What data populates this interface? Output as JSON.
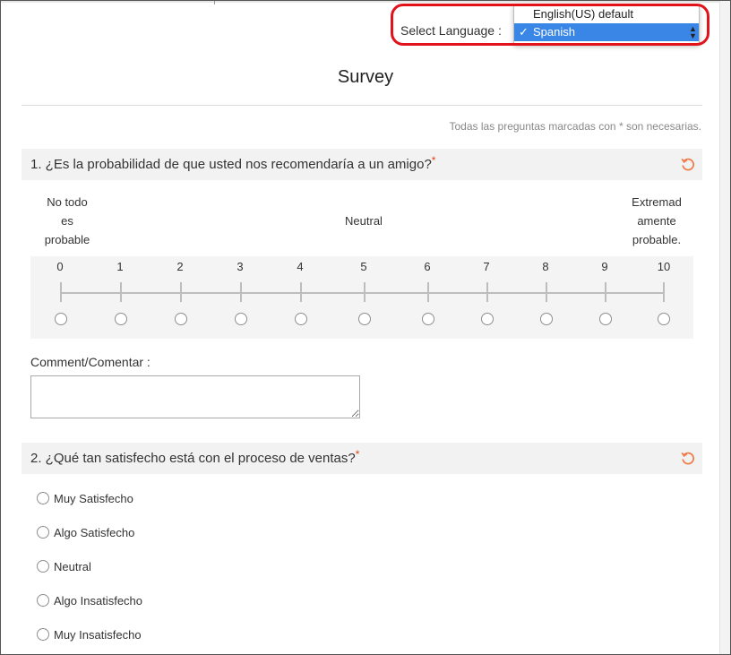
{
  "language": {
    "label": "Select Language :",
    "options": [
      {
        "text": "English(US) default",
        "selected": false
      },
      {
        "text": "Spanish",
        "selected": true
      }
    ],
    "check_glyph": "✓",
    "highlight_color": "#e2121b",
    "selected_color": "#3a86e6"
  },
  "survey": {
    "title": "Survey",
    "required_note": "Todas las preguntas marcadas con * son necesarias.",
    "required_marker": "*"
  },
  "q1": {
    "text": "1. ¿Es la probabilidad de que usted nos recomendaría a un amigo?",
    "label_low": [
      "No todo",
      "es",
      "probable"
    ],
    "label_mid": "Neutral",
    "label_high": [
      "Extremad",
      "amente",
      "probable."
    ],
    "scale": [
      "0",
      "1",
      "2",
      "3",
      "4",
      "5",
      "6",
      "7",
      "8",
      "9",
      "10"
    ],
    "comment_label": "Comment/Comentar :",
    "comment_value": ""
  },
  "q2": {
    "text": "2. ¿Qué tan satisfecho está con el proceso de ventas?",
    "options": [
      "Muy Satisfecho",
      "Algo Satisfecho",
      "Neutral",
      "Algo Insatisfecho",
      "Muy Insatisfecho"
    ]
  },
  "icons": {
    "reset": "reset-icon",
    "select_arrows": "updown-arrow-icon"
  },
  "colors": {
    "accent": "#f07c4a",
    "required": "#e2421b"
  }
}
